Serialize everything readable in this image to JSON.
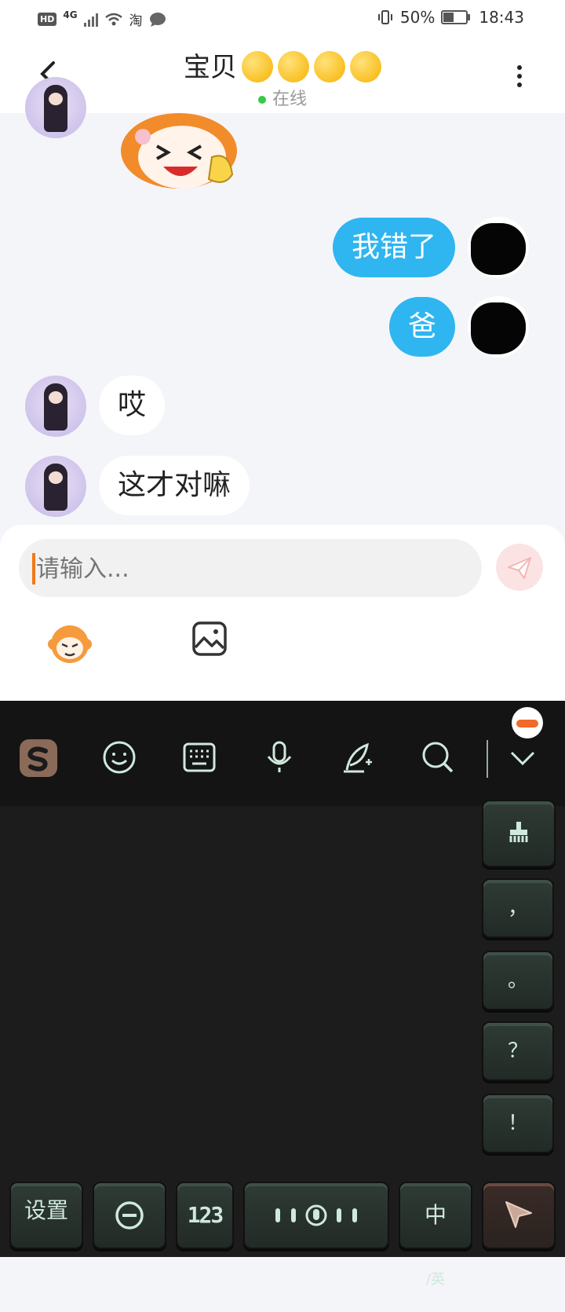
{
  "statusbar": {
    "left_badge": "HD",
    "network": "4G",
    "taobao": "淘",
    "battery_level": "50%",
    "battery_fraction": 0.5,
    "time": "18:43"
  },
  "header": {
    "title": "宝贝",
    "title_emojis": [
      "kissing-face",
      "kissing-face",
      "kissing-face",
      "kissing-heart-face"
    ],
    "status": "在线",
    "status_color": "#33cc44"
  },
  "messages": [
    {
      "side": "in",
      "type": "sticker",
      "sticker": "laughing-cartoon-girl-sticker"
    },
    {
      "side": "out",
      "text": "我错了"
    },
    {
      "side": "out",
      "text": "爸"
    },
    {
      "side": "in",
      "text": "哎"
    },
    {
      "side": "in",
      "text": "这才对嘛"
    }
  ],
  "composer": {
    "placeholder": "请输入...",
    "send_icon": "paper-plane-icon",
    "tools": [
      "monkey-emoji-icon",
      "image-icon"
    ]
  },
  "keyboard": {
    "toolbar_icons": [
      "sogou-logo-icon",
      "smiley-icon",
      "keyboard-icon",
      "microphone-icon",
      "handwriting-icon",
      "search-icon",
      "chevron-down-icon"
    ],
    "side_keys": [
      "清空",
      "，",
      "。",
      "？",
      "！"
    ],
    "bottom": {
      "settings": "设置",
      "minus_symbol": "⊖",
      "numbers": "123",
      "lang_main": "中",
      "lang_alt": "/英"
    },
    "accent": "#cfe9dc",
    "colors": {
      "outgoing_bubble": "#2fb5f0",
      "cursor": "#f07a1a"
    }
  }
}
